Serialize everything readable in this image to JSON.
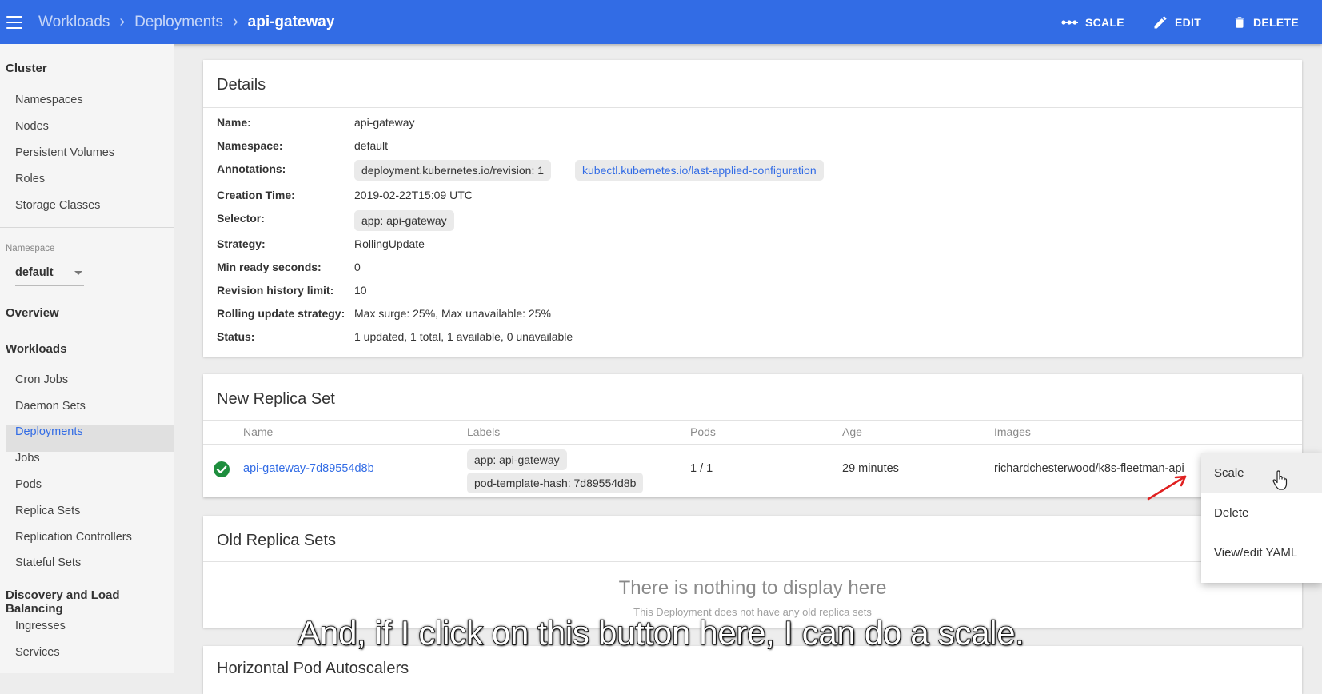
{
  "header": {
    "breadcrumb": [
      "Workloads",
      "Deployments"
    ],
    "current": "api-gateway",
    "actions": {
      "scale": "SCALE",
      "edit": "EDIT",
      "delete": "DELETE"
    },
    "color": "#326ce5"
  },
  "sidebar": {
    "cluster_header": "Cluster",
    "cluster_items": [
      "Namespaces",
      "Nodes",
      "Persistent Volumes",
      "Roles",
      "Storage Classes"
    ],
    "namespace_caption": "Namespace",
    "namespace_value": "default",
    "overview": "Overview",
    "workloads_header": "Workloads",
    "workload_items": [
      "Cron Jobs",
      "Daemon Sets",
      "Deployments",
      "Jobs",
      "Pods",
      "Replica Sets",
      "Replication Controllers",
      "Stateful Sets"
    ],
    "active_item": "Deployments",
    "discovery_header": "Discovery and Load Balancing",
    "discovery_items": [
      "Ingresses",
      "Services"
    ]
  },
  "details": {
    "title": "Details",
    "name_label": "Name:",
    "name": "api-gateway",
    "namespace_label": "Namespace:",
    "namespace": "default",
    "annotations_label": "Annotations:",
    "annotation_revision": "deployment.kubernetes.io/revision:  1",
    "annotation_config": "kubectl.kubernetes.io/last-applied-configuration",
    "creation_label": "Creation Time:",
    "creation": "2019-02-22T15:09 UTC",
    "selector_label": "Selector:",
    "selector": "app: api-gateway",
    "strategy_label": "Strategy:",
    "strategy": "RollingUpdate",
    "min_ready_label": "Min ready seconds:",
    "min_ready": "0",
    "revision_limit_label": "Revision history limit:",
    "revision_limit": "10",
    "rolling_label": "Rolling update strategy:",
    "rolling": "Max surge: 25%, Max unavailable: 25%",
    "status_label": "Status:",
    "status": "1 updated, 1 total, 1 available, 0 unavailable"
  },
  "new_replica_set": {
    "title": "New Replica Set",
    "columns": {
      "name": "Name",
      "labels": "Labels",
      "pods": "Pods",
      "age": "Age",
      "images": "Images"
    },
    "row": {
      "name": "api-gateway-7d89554d8b",
      "label_app": "app: api-gateway",
      "label_hash": "pod-template-hash: 7d89554d8b",
      "pods": "1 / 1",
      "age": "29 minutes",
      "image": "richardchesterwood/k8s-fleetman-api"
    }
  },
  "old_replica_sets": {
    "title": "Old Replica Sets",
    "empty_title": "There is nothing to display here",
    "empty_sub": "This Deployment does not have any old replica sets"
  },
  "hpa": {
    "title": "Horizontal Pod Autoscalers"
  },
  "context_menu": {
    "items": [
      "Scale",
      "Delete",
      "View/edit YAML"
    ]
  },
  "subtitle": "And, if I click on this button here, I can do a scale."
}
